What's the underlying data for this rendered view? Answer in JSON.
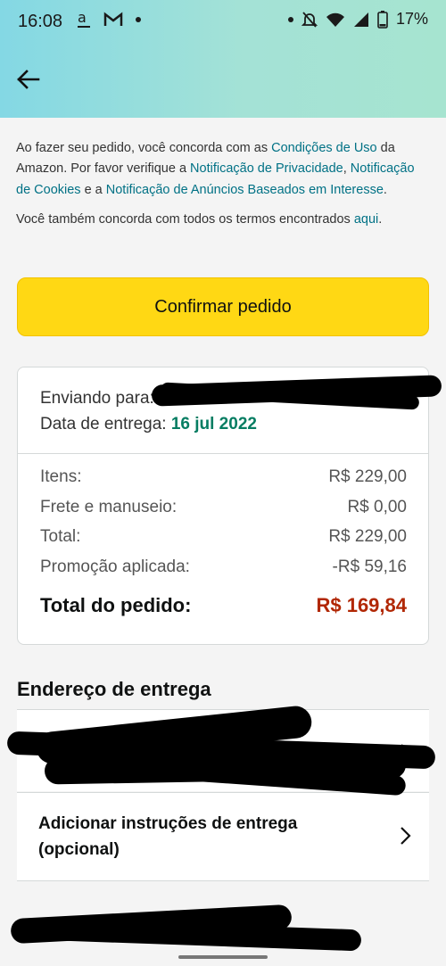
{
  "status_bar": {
    "time": "16:08",
    "battery": "17%"
  },
  "legal": {
    "part1": "Ao fazer seu pedido, você concorda com as ",
    "link_terms": "Condições de Uso",
    "part2": " da Amazon. Por favor verifique a ",
    "link_privacy": "Notificação de Privacidade",
    "part3": ", ",
    "link_cookies": "Notificação de Cookies",
    "part4": " e a ",
    "link_ads": "Notificação de Anúncios Baseados em Interesse",
    "part5": ".",
    "also_text": "Você também concorda com todos os termos encontrados ",
    "link_here": "aqui",
    "also_end": "."
  },
  "confirm_button": "Confirmar pedido",
  "shipping": {
    "sending_label": "Enviando para:",
    "delivery_label": "Data de entrega:",
    "delivery_date": "16 jul 2022"
  },
  "summary": [
    {
      "label": "Itens:",
      "value": "R$ 229,00"
    },
    {
      "label": "Frete e manuseio:",
      "value": "R$ 0,00"
    },
    {
      "label": "Total:",
      "value": "R$ 229,00"
    },
    {
      "label": "Promoção aplicada:",
      "value": "-R$ 59,16"
    }
  ],
  "order_total": {
    "label": "Total do pedido:",
    "value": "R$ 169,84"
  },
  "address": {
    "title": "Endereço de entrega",
    "instructions_line1": "Adicionar instruções de entrega",
    "instructions_line2": "(opcional)"
  },
  "colors": {
    "button": "#ffd814",
    "link": "#007185",
    "date": "#067d62",
    "total": "#b12704"
  }
}
